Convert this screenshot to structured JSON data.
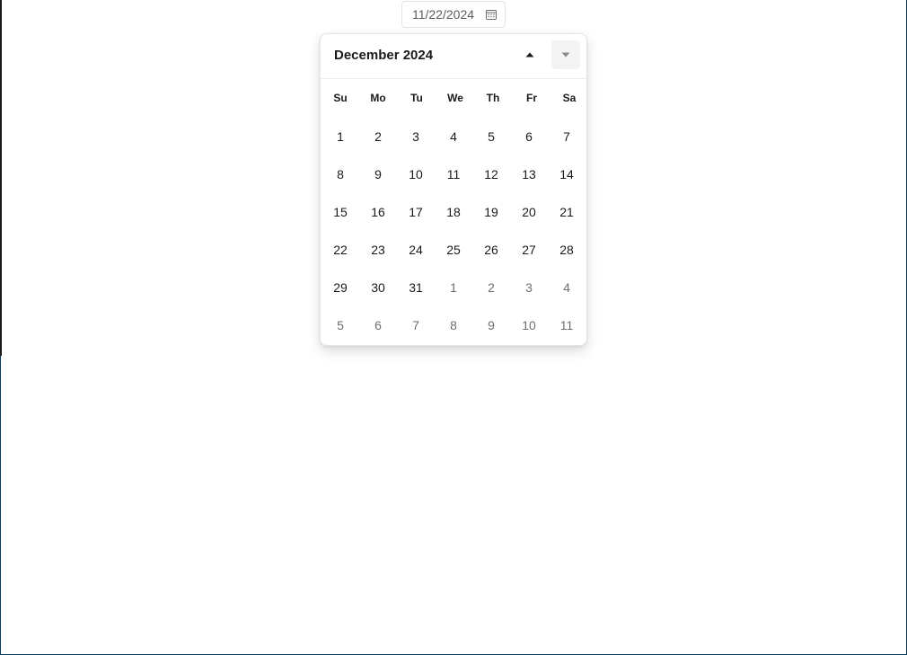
{
  "date_input": {
    "value": "11/22/2024",
    "icon": "calendar-icon"
  },
  "calendar": {
    "month_title": "December 2024",
    "prev_icon": "triangle-up-icon",
    "next_icon": "triangle-down-icon",
    "weekdays": [
      "Su",
      "Mo",
      "Tu",
      "We",
      "Th",
      "Fr",
      "Sa"
    ],
    "weeks": [
      [
        {
          "d": "1",
          "out": false
        },
        {
          "d": "2",
          "out": false
        },
        {
          "d": "3",
          "out": false
        },
        {
          "d": "4",
          "out": false
        },
        {
          "d": "5",
          "out": false
        },
        {
          "d": "6",
          "out": false
        },
        {
          "d": "7",
          "out": false
        }
      ],
      [
        {
          "d": "8",
          "out": false
        },
        {
          "d": "9",
          "out": false
        },
        {
          "d": "10",
          "out": false
        },
        {
          "d": "11",
          "out": false
        },
        {
          "d": "12",
          "out": false
        },
        {
          "d": "13",
          "out": false
        },
        {
          "d": "14",
          "out": false
        }
      ],
      [
        {
          "d": "15",
          "out": false
        },
        {
          "d": "16",
          "out": false
        },
        {
          "d": "17",
          "out": false
        },
        {
          "d": "18",
          "out": false
        },
        {
          "d": "19",
          "out": false
        },
        {
          "d": "20",
          "out": false
        },
        {
          "d": "21",
          "out": false
        }
      ],
      [
        {
          "d": "22",
          "out": false
        },
        {
          "d": "23",
          "out": false
        },
        {
          "d": "24",
          "out": false
        },
        {
          "d": "25",
          "out": false
        },
        {
          "d": "26",
          "out": false
        },
        {
          "d": "27",
          "out": false
        },
        {
          "d": "28",
          "out": false
        }
      ],
      [
        {
          "d": "29",
          "out": false
        },
        {
          "d": "30",
          "out": false
        },
        {
          "d": "31",
          "out": false
        },
        {
          "d": "1",
          "out": true
        },
        {
          "d": "2",
          "out": true
        },
        {
          "d": "3",
          "out": true
        },
        {
          "d": "4",
          "out": true
        }
      ],
      [
        {
          "d": "5",
          "out": true
        },
        {
          "d": "6",
          "out": true
        },
        {
          "d": "7",
          "out": true
        },
        {
          "d": "8",
          "out": true
        },
        {
          "d": "9",
          "out": true
        },
        {
          "d": "10",
          "out": true
        },
        {
          "d": "11",
          "out": true
        }
      ]
    ]
  },
  "colors": {
    "frame_border": "#0b3d5c",
    "text": "#1a1a1a",
    "outside_day_text": "#6e6e6e",
    "hover_bg": "#f3f3f3"
  }
}
